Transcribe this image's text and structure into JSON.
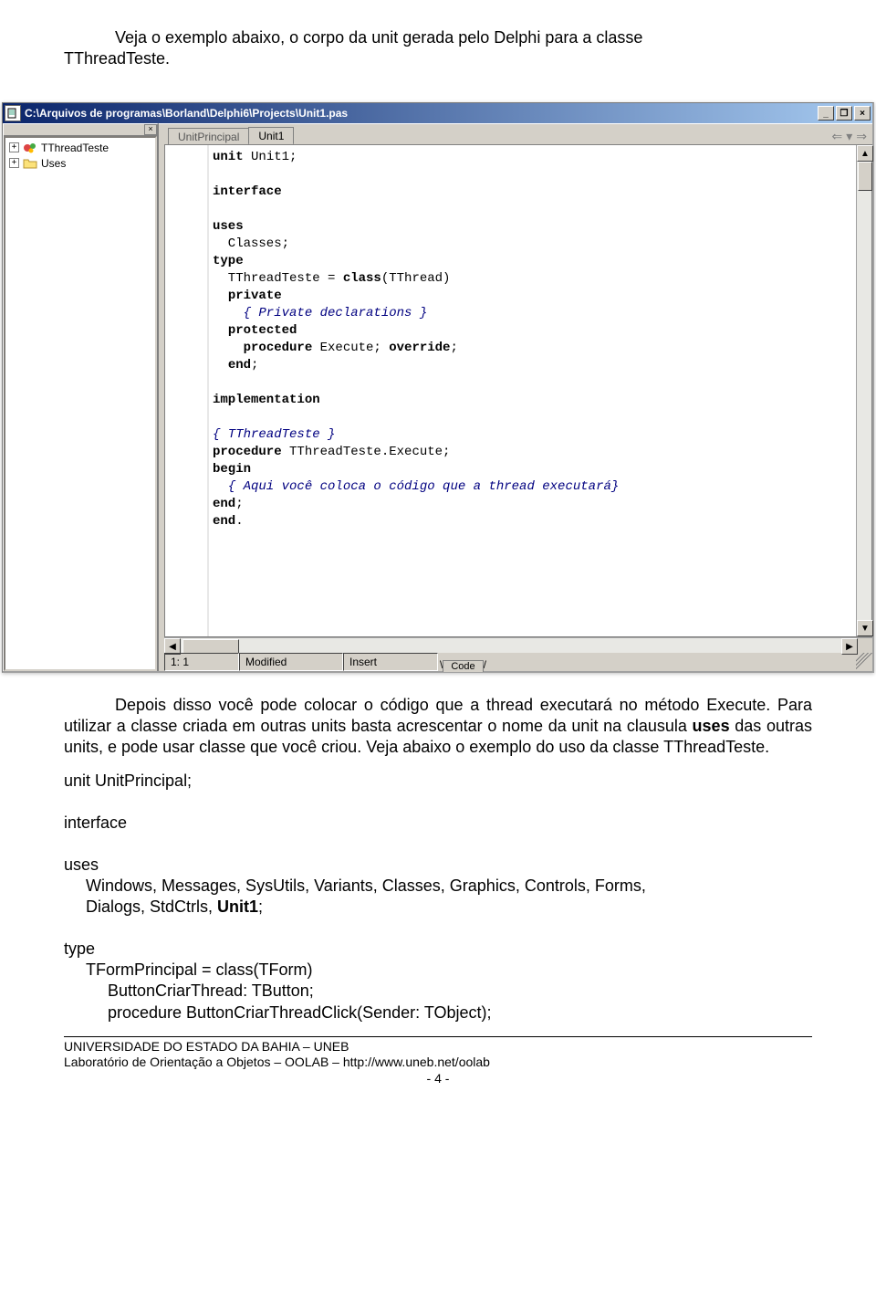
{
  "intro_text_a": "Veja o exemplo abaixo, o corpo da unit gerada pelo Delphi para a classe",
  "intro_text_b": "TThreadTeste.",
  "ide": {
    "titlebar_icon_name": "document-icon",
    "title": "C:\\Arquivos de programas\\Borland\\Delphi6\\Projects\\Unit1.pas",
    "winbtn_minimize_glyph": "_",
    "winbtn_restore_glyph": "❐",
    "winbtn_close_glyph": "×",
    "tree_close_glyph": "×",
    "tree_items": [
      {
        "expander": "+",
        "icon": "gears",
        "label": "TThreadTeste"
      },
      {
        "expander": "+",
        "icon": "folder",
        "label": "Uses"
      }
    ],
    "tabs": {
      "inactive": "UnitPrincipal",
      "active": "Unit1",
      "nav_back": "⇐",
      "nav_drop": "▾",
      "nav_fwd": "⇒"
    },
    "code_lines": [
      {
        "t": "kw",
        "s": "unit "
      },
      {
        "t": "",
        "s": "Unit1;"
      },
      "nl",
      "nl",
      {
        "t": "kw",
        "s": "interface"
      },
      "nl",
      "nl",
      {
        "t": "kw",
        "s": "uses"
      },
      "nl",
      {
        "t": "",
        "s": "  Classes;"
      },
      "nl",
      {
        "t": "kw",
        "s": "type"
      },
      "nl",
      {
        "t": "",
        "s": "  TThreadTeste = "
      },
      {
        "t": "kw",
        "s": "class"
      },
      {
        "t": "",
        "s": "(TThread)"
      },
      "nl",
      {
        "t": "",
        "s": "  "
      },
      {
        "t": "kw",
        "s": "private"
      },
      "nl",
      {
        "t": "cm",
        "s": "    { Private declarations }"
      },
      "nl",
      {
        "t": "",
        "s": "  "
      },
      {
        "t": "kw",
        "s": "protected"
      },
      "nl",
      {
        "t": "",
        "s": "    "
      },
      {
        "t": "kw",
        "s": "procedure "
      },
      {
        "t": "",
        "s": "Execute; "
      },
      {
        "t": "kw",
        "s": "override"
      },
      {
        "t": "",
        "s": ";"
      },
      "nl",
      {
        "t": "",
        "s": "  "
      },
      {
        "t": "kw",
        "s": "end"
      },
      {
        "t": "",
        "s": ";"
      },
      "nl",
      "nl",
      {
        "t": "kw",
        "s": "implementation"
      },
      "nl",
      "nl",
      {
        "t": "cm",
        "s": "{ TThreadTeste }"
      },
      "nl",
      {
        "t": "kw",
        "s": "procedure "
      },
      {
        "t": "",
        "s": "TThreadTeste.Execute;"
      },
      "nl",
      {
        "t": "kw",
        "s": "begin"
      },
      "nl",
      {
        "t": "cm",
        "s": "  { Aqui você coloca o código que a thread executará}"
      },
      "nl",
      {
        "t": "kw",
        "s": "end"
      },
      {
        "t": "",
        "s": ";"
      },
      "nl",
      {
        "t": "kw",
        "s": "end"
      },
      {
        "t": "",
        "s": "."
      },
      "nl"
    ],
    "scroll_up": "▲",
    "scroll_down": "▼",
    "scroll_left": "◀",
    "scroll_right": "▶",
    "status": {
      "pos": "1: 1",
      "modified": "Modified",
      "insert": "Insert",
      "code_tab": "Code"
    }
  },
  "para2_a": "Depois disso você pode colocar o código que a thread executará no método",
  "para2_b": "Execute. Para utilizar a classe criada em outras units basta acrescentar o nome da unit na clausula ",
  "para2_c": " das outras units, e pode usar classe que você criou. Veja abaixo o exemplo do uso da classe TThreadTeste.",
  "uses_word": "uses",
  "code2": {
    "l1": "unit UnitPrincipal;",
    "l2": "interface",
    "l3": "uses",
    "l4": "Windows, Messages, SysUtils, Variants, Classes, Graphics, Controls, Forms,",
    "l5": "Dialogs, StdCtrls, ",
    "l5b": "Unit1",
    "l5c": ";",
    "l6": "type",
    "l7": "TFormPrincipal = class(TForm)",
    "l8": "ButtonCriarThread: TButton;",
    "l9": "procedure ButtonCriarThreadClick(Sender: TObject);"
  },
  "footer": {
    "line1": "UNIVERSIDADE DO ESTADO DA BAHIA – UNEB",
    "line2": "Laboratório de Orientação a Objetos – OOLAB – http://www.uneb.net/oolab",
    "page": "- 4 -"
  }
}
